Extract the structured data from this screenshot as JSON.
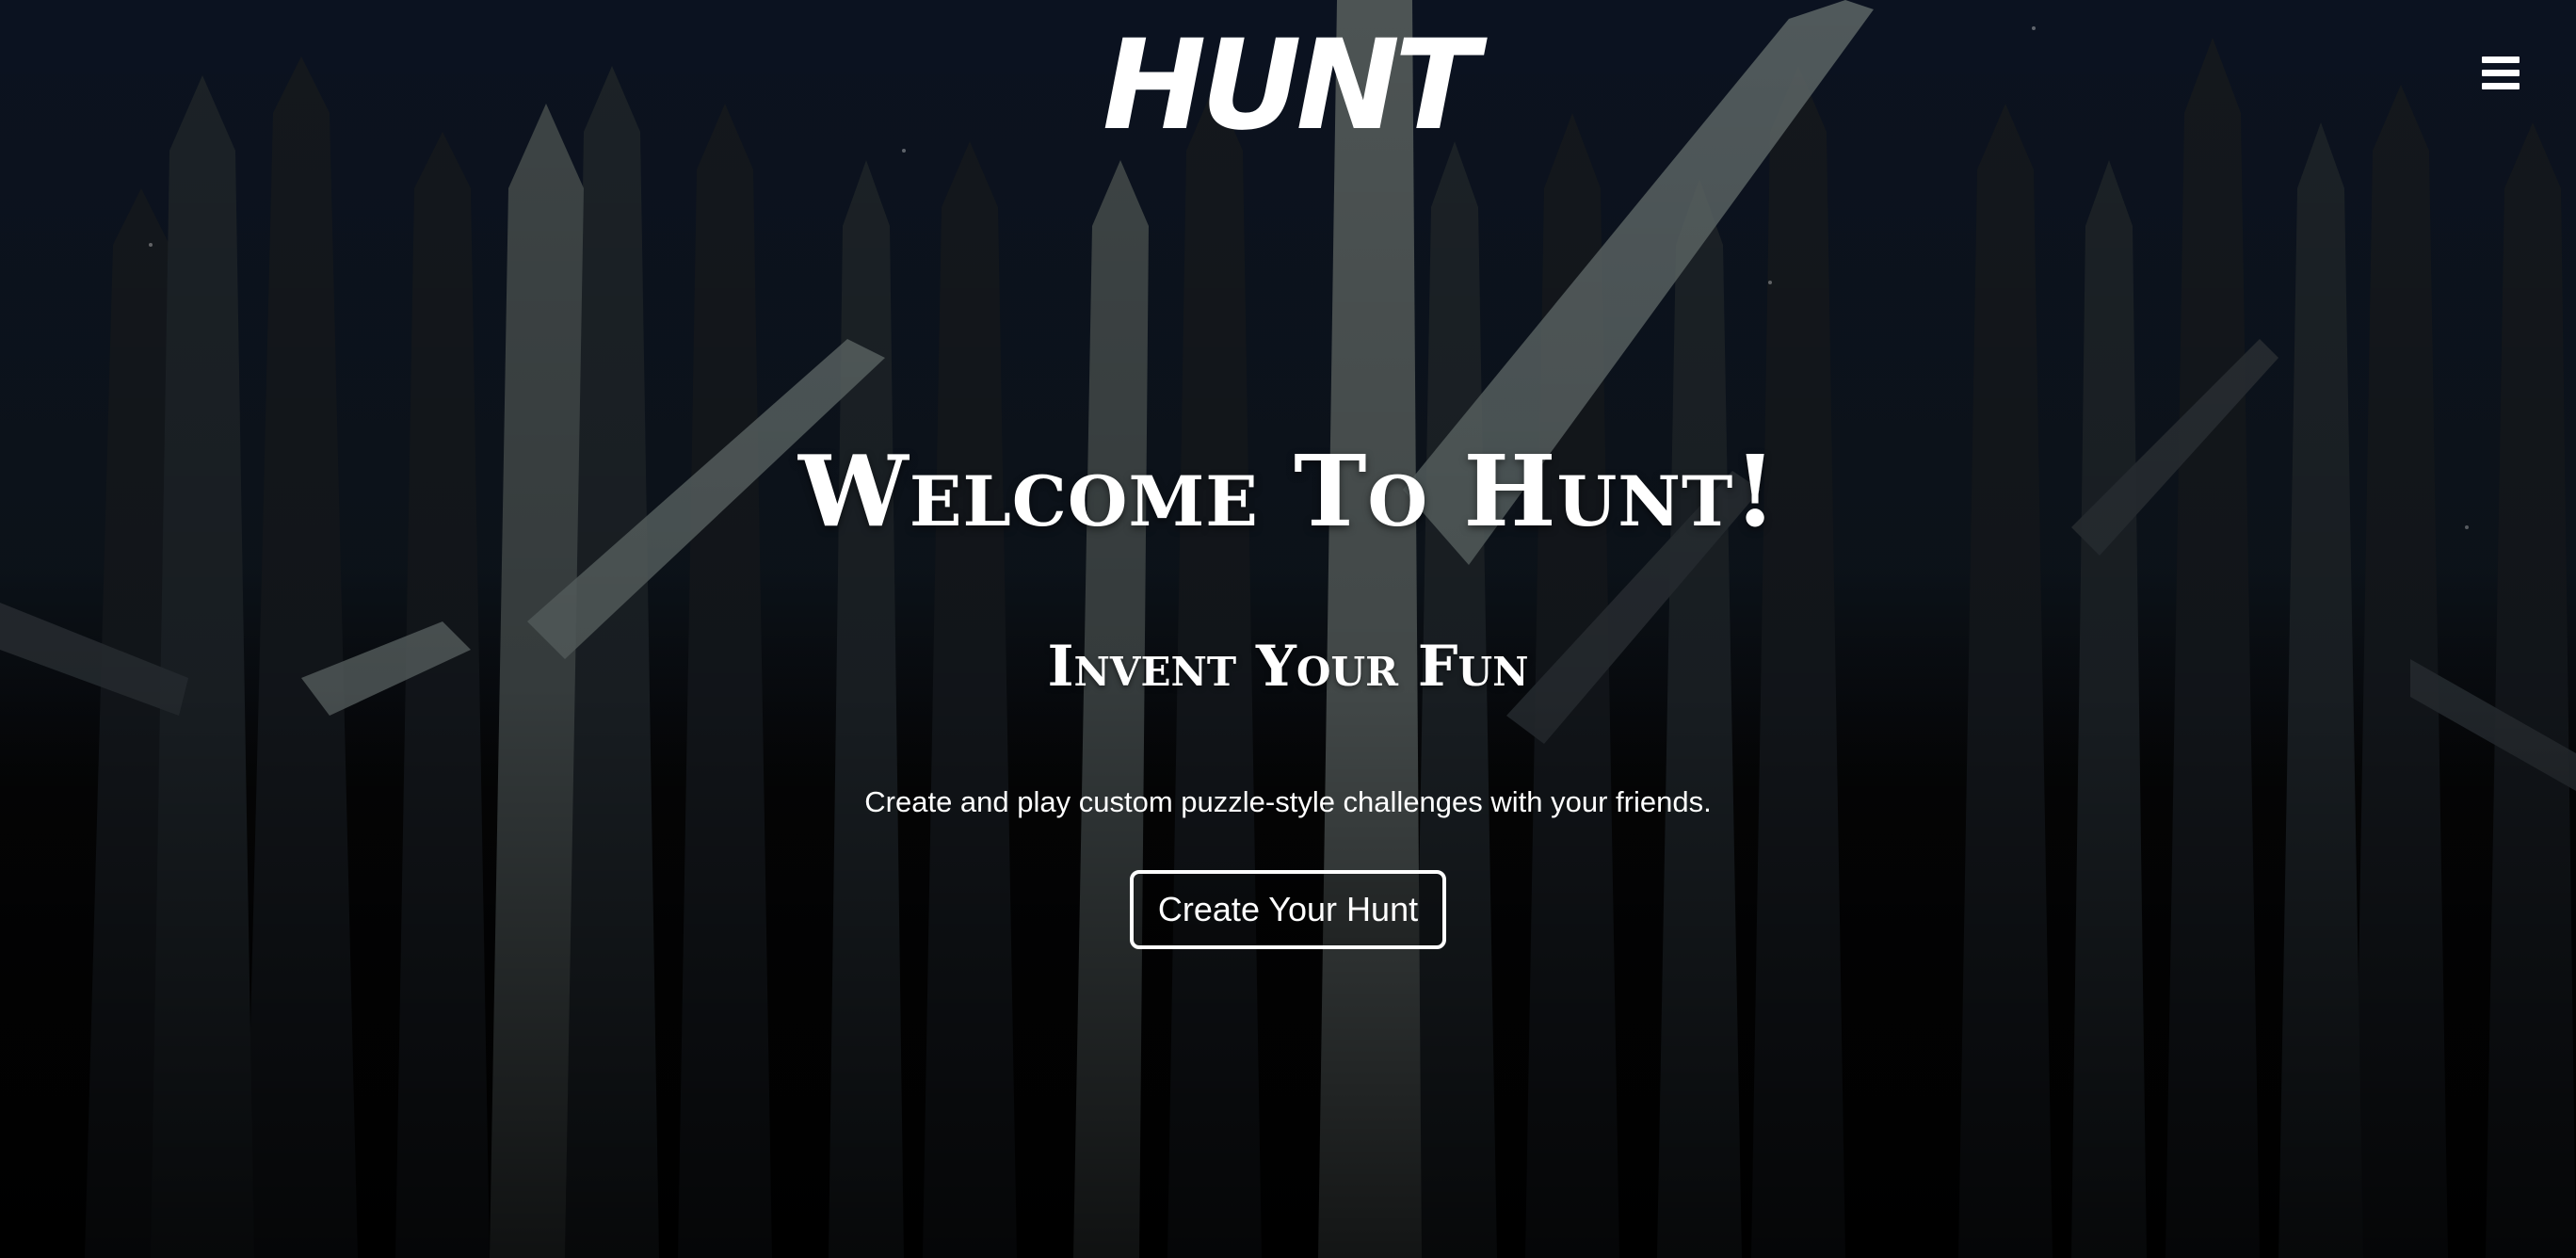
{
  "header": {
    "logo_text": "HUNT",
    "menu_icon": "hamburger-menu-icon"
  },
  "hero": {
    "title": "Welcome To Hunt!",
    "subtitle": "Invent Your Fun",
    "description": "Create and play custom puzzle-style challenges with your friends.",
    "cta_label": "Create Your Hunt"
  },
  "colors": {
    "text": "#ffffff",
    "background": "#0b1220"
  }
}
